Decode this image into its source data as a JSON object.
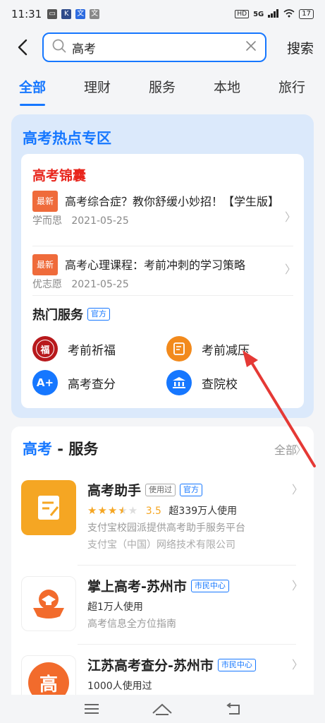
{
  "status_bar": {
    "time": "11:31",
    "network": "5G",
    "battery": "17"
  },
  "search": {
    "value": "高考",
    "button_label": "搜索"
  },
  "tabs": [
    {
      "label": "全部"
    },
    {
      "label": "理财"
    },
    {
      "label": "服务"
    },
    {
      "label": "本地"
    },
    {
      "label": "旅行"
    }
  ],
  "hot_zone": {
    "title": "高考热点专区",
    "tips_title": "高考锦囊",
    "news": [
      {
        "tag": "最新",
        "title": "高考综合症？教你舒缓小妙招！【学生版】",
        "source": "学而思",
        "date": "2021-05-25"
      },
      {
        "tag": "最新",
        "title": "高考心理课程：考前冲刺的学习策略",
        "source": "优志愿",
        "date": "2021-05-25"
      }
    ],
    "services_title": "热门服务",
    "services_badge": "官方",
    "services": [
      {
        "label": "考前祈福",
        "icon": "fortune-icon",
        "icon_text": "福",
        "color": "#b8191c"
      },
      {
        "label": "考前减压",
        "icon": "note-icon",
        "color": "#f28a1c"
      },
      {
        "label": "高考查分",
        "icon": "score-icon",
        "icon_text": "A+",
        "color": "#1677ff"
      },
      {
        "label": "查院校",
        "icon": "university-icon",
        "color": "#1677ff"
      }
    ]
  },
  "services_panel": {
    "title_keyword": "高考",
    "title_rest": " - 服务",
    "all_label": "全部",
    "apps": [
      {
        "name": "高考助手",
        "badges": [
          "使用过",
          "官方"
        ],
        "rating": "3.5",
        "users": "超339万人使用",
        "desc": "支付宝校园派提供高考助手服务平台",
        "provider": "支付宝（中国）网络技术有限公司",
        "icon_color": "#f5a623",
        "icon": "exam-assistant-icon"
      },
      {
        "name": "掌上高考-苏州市",
        "badges": [
          "市民中心"
        ],
        "users": "超1万人使用",
        "desc": "高考信息全方位指南",
        "icon_color": "#f26b2c",
        "icon": "graduation-cap-icon"
      },
      {
        "name": "江苏高考查分-苏州市",
        "badges": [
          "市民中心"
        ],
        "users": "1000人使用过",
        "icon_text": "高",
        "icon_color": "#f26b2c",
        "icon": "exam-score-icon"
      }
    ]
  },
  "colors": {
    "accent": "#1677ff",
    "alert": "#e8251c",
    "arrow": "#e53935"
  }
}
